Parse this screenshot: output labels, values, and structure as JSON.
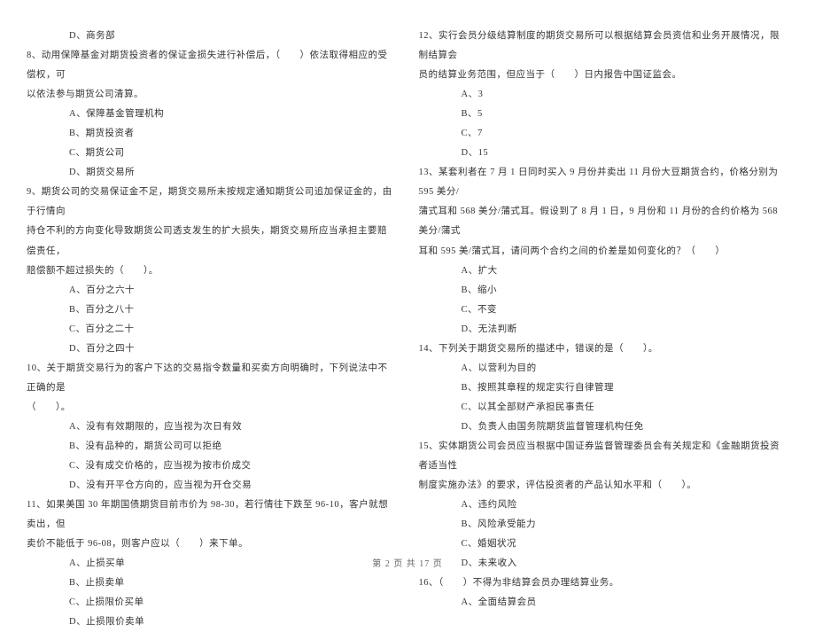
{
  "left": [
    {
      "cls": "indent-opt",
      "text": "D、商务部"
    },
    {
      "cls": "",
      "text": "8、动用保障基金对期货投资者的保证金损失进行补偿后，（　　）依法取得相应的受偿权，可"
    },
    {
      "cls": "",
      "text": "以依法参与期货公司清算。"
    },
    {
      "cls": "indent-opt",
      "text": "A、保障基金管理机构"
    },
    {
      "cls": "indent-opt",
      "text": "B、期货投资者"
    },
    {
      "cls": "indent-opt",
      "text": "C、期货公司"
    },
    {
      "cls": "indent-opt",
      "text": "D、期货交易所"
    },
    {
      "cls": "",
      "text": "9、期货公司的交易保证金不足，期货交易所未按规定通知期货公司追加保证金的，由于行情向"
    },
    {
      "cls": "",
      "text": "持仓不利的方向变化导致期货公司透支发生的扩大损失，期货交易所应当承担主要赔偿责任，"
    },
    {
      "cls": "",
      "text": "赔偿额不超过损失的（　　）。"
    },
    {
      "cls": "indent-opt",
      "text": "A、百分之六十"
    },
    {
      "cls": "indent-opt",
      "text": "B、百分之八十"
    },
    {
      "cls": "indent-opt",
      "text": "C、百分之二十"
    },
    {
      "cls": "indent-opt",
      "text": "D、百分之四十"
    },
    {
      "cls": "",
      "text": "10、关于期货交易行为的客户下达的交易指令数量和买卖方向明确时，下列说法中不正确的是"
    },
    {
      "cls": "",
      "text": "（　　）。"
    },
    {
      "cls": "indent-opt",
      "text": "A、没有有效期限的，应当视为次日有效"
    },
    {
      "cls": "indent-opt",
      "text": "B、没有品种的，期货公司可以拒绝"
    },
    {
      "cls": "indent-opt",
      "text": "C、没有成交价格的，应当视为按市价成交"
    },
    {
      "cls": "indent-opt",
      "text": "D、没有开平仓方向的，应当视为开仓交易"
    },
    {
      "cls": "",
      "text": "11、如果美国 30 年期国债期货目前市价为 98-30，若行情往下跌至 96-10，客户就想卖出，但"
    },
    {
      "cls": "",
      "text": "卖价不能低于 96-08，则客户应以（　　）来下单。"
    },
    {
      "cls": "indent-opt",
      "text": "A、止损买单"
    },
    {
      "cls": "indent-opt",
      "text": "B、止损卖单"
    },
    {
      "cls": "indent-opt",
      "text": "C、止损限价买单"
    },
    {
      "cls": "indent-opt",
      "text": "D、止损限价卖单"
    }
  ],
  "right": [
    {
      "cls": "",
      "text": "12、实行会员分级结算制度的期货交易所可以根据结算会员资信和业务开展情况，限制结算会"
    },
    {
      "cls": "",
      "text": "员的结算业务范围，但应当于（　　）日内报告中国证监会。"
    },
    {
      "cls": "indent-opt",
      "text": "A、3"
    },
    {
      "cls": "indent-opt",
      "text": "B、5"
    },
    {
      "cls": "indent-opt",
      "text": "C、7"
    },
    {
      "cls": "indent-opt",
      "text": "D、15"
    },
    {
      "cls": "",
      "text": "13、某套利者在 7 月 1 日同时买入 9 月份并卖出 11 月份大豆期货合约，价格分别为 595 美分/"
    },
    {
      "cls": "",
      "text": "蒲式耳和 568 美分/蒲式耳。假设到了 8 月 1 日，9 月份和 11 月份的合约价格为 568 美分/蒲式"
    },
    {
      "cls": "",
      "text": "耳和 595 美/蒲式耳，请问两个合约之间的价差是如何变化的？（　　）"
    },
    {
      "cls": "indent-opt",
      "text": "A、扩大"
    },
    {
      "cls": "indent-opt",
      "text": "B、缩小"
    },
    {
      "cls": "indent-opt",
      "text": "C、不变"
    },
    {
      "cls": "indent-opt",
      "text": "D、无法判断"
    },
    {
      "cls": "",
      "text": "14、下列关于期货交易所的描述中，错误的是（　　）。"
    },
    {
      "cls": "indent-opt",
      "text": "A、以营利为目的"
    },
    {
      "cls": "indent-opt",
      "text": "B、按照其章程的规定实行自律管理"
    },
    {
      "cls": "indent-opt",
      "text": "C、以其全部财产承担民事责任"
    },
    {
      "cls": "indent-opt",
      "text": "D、负责人由国务院期货监督管理机构任免"
    },
    {
      "cls": "",
      "text": "15、实体期货公司会员应当根据中国证券监督管理委员会有关规定和《金融期货投资者适当性"
    },
    {
      "cls": "",
      "text": "制度实施办法》的要求，评估投资者的产品认知水平和（　　）。"
    },
    {
      "cls": "indent-opt",
      "text": "A、违约风险"
    },
    {
      "cls": "indent-opt",
      "text": "B、风险承受能力"
    },
    {
      "cls": "indent-opt",
      "text": "C、婚姻状况"
    },
    {
      "cls": "indent-opt",
      "text": "D、未来收入"
    },
    {
      "cls": "",
      "text": "16、（　　）不得为非结算会员办理结算业务。"
    },
    {
      "cls": "indent-opt",
      "text": "A、全面结算会员"
    }
  ],
  "footer": "第 2 页 共 17 页"
}
